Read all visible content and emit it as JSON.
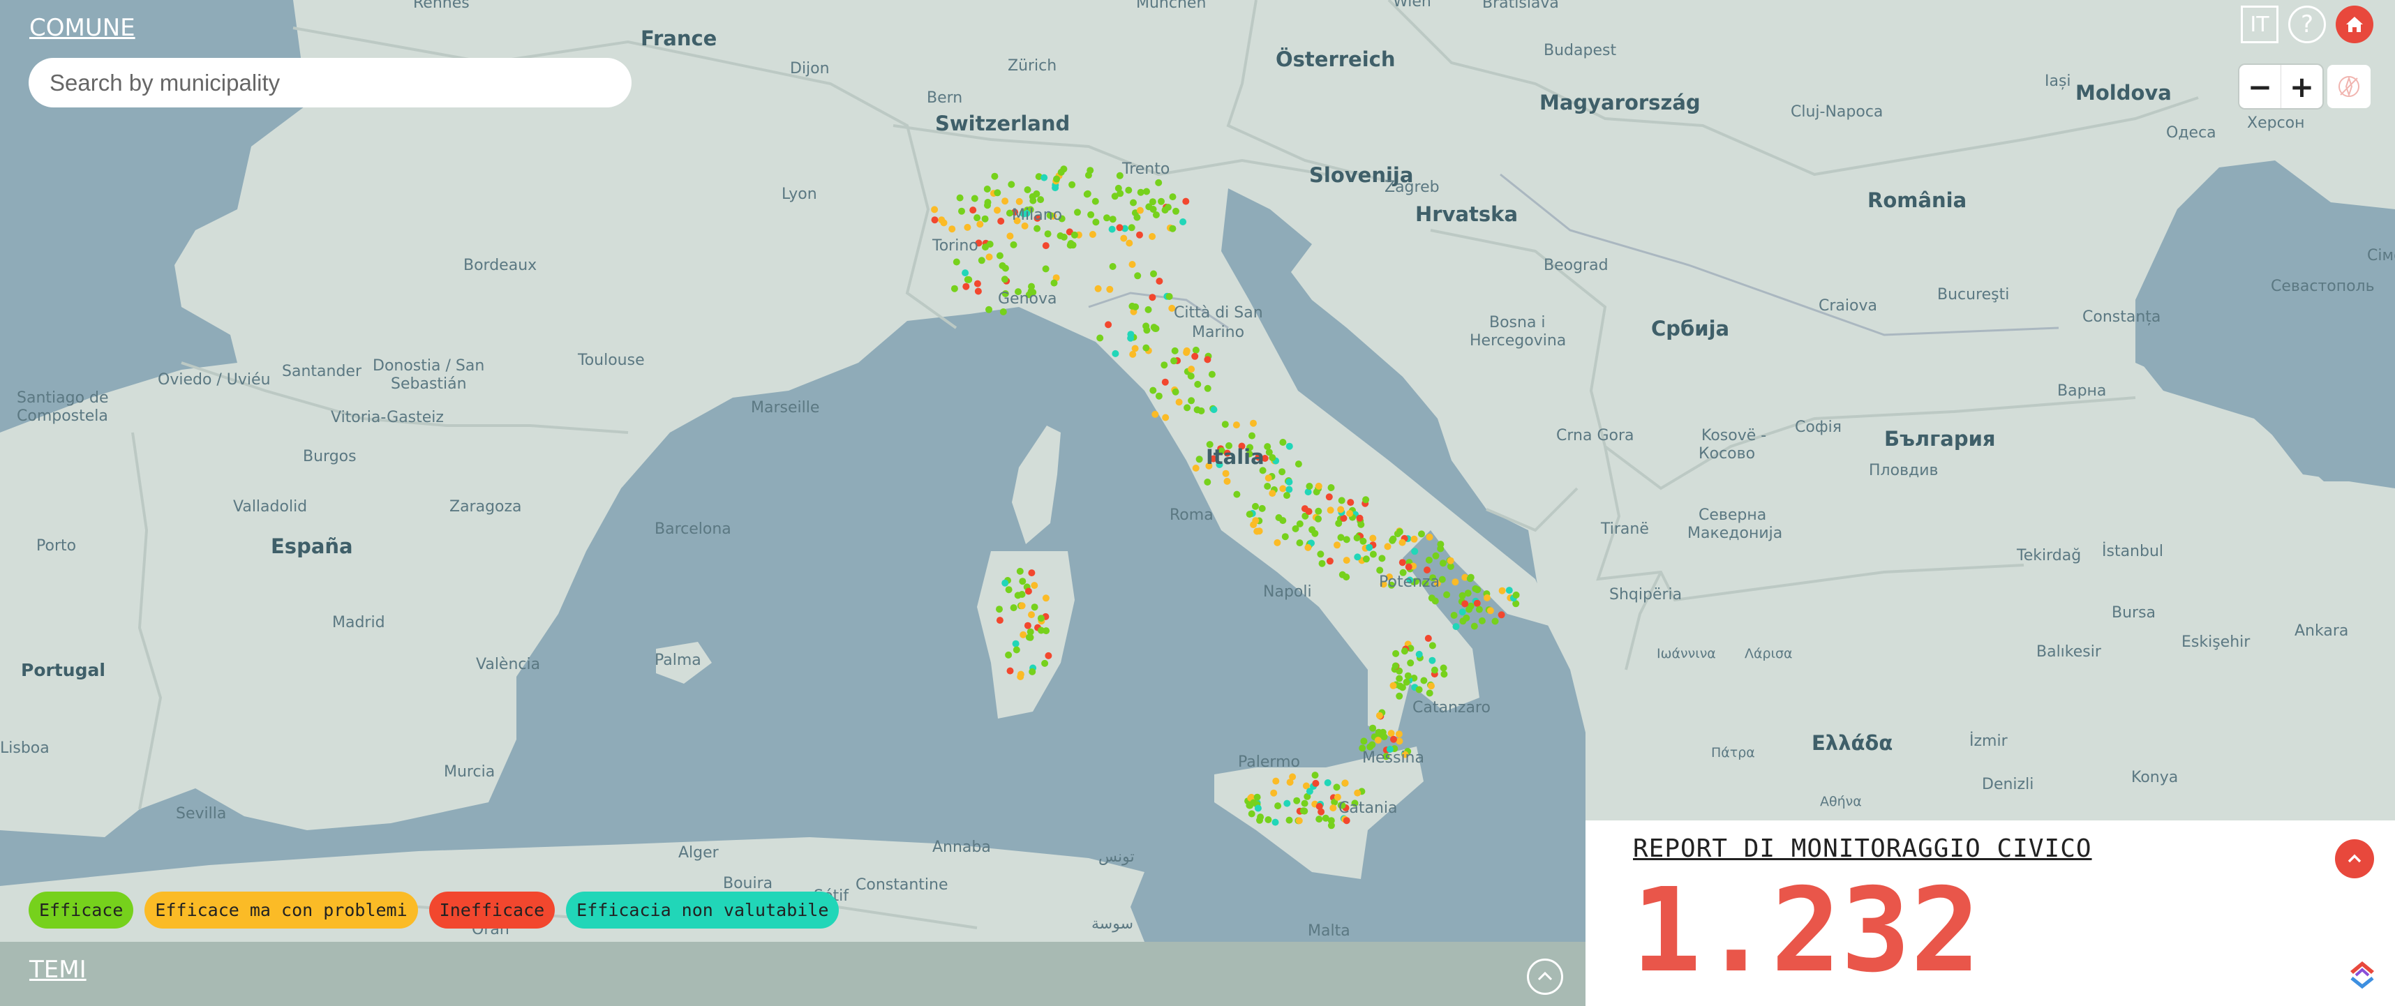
{
  "header": {
    "comune_label": "COMUNE",
    "search_placeholder": "Search by municipality"
  },
  "toolbar": {
    "language": "IT",
    "help": "?",
    "zoom_out": "−",
    "zoom_in": "+"
  },
  "legend": [
    {
      "label": "Efficace",
      "color": "#76d11c"
    },
    {
      "label": "Efficace ma con problemi",
      "color": "#fbbb26"
    },
    {
      "label": "Inefficace",
      "color": "#f2472e"
    },
    {
      "label": "Efficacia non valutabile",
      "color": "#21d6b8"
    }
  ],
  "temi": {
    "label": "TEMI"
  },
  "report": {
    "title": "REPORT DI MONITORAGGIO CIVICO",
    "count": "1.232"
  },
  "icons": {
    "home": "home-icon",
    "help": "help-icon",
    "compass": "compass-off-icon",
    "collapse": "chevron-up-icon",
    "brand": "brand-logo-icon"
  },
  "map": {
    "countries": [
      "France",
      "Switzerland",
      "Österreich",
      "Magyarország",
      "Slovenija",
      "Hrvatska",
      "România",
      "Moldova",
      "Bosna i",
      "Hercegovina",
      "Србија",
      "Crna Gora",
      "Kosovë -",
      "Косово",
      "Северна",
      "Македонија",
      "Shqipëria",
      "България",
      "Ελλάδα",
      "Italia",
      "España",
      "Portugal"
    ],
    "cities": [
      "Rennes",
      "München",
      "Wien",
      "Bratislava",
      "Budapest",
      "Zürich",
      "Bern",
      "Dijon",
      "Lyon",
      "Trento",
      "Milano",
      "Torino",
      "Genova",
      "Zagreb",
      "Bordeaux",
      "Toulouse",
      "Città di San",
      "Marino",
      "Beograd",
      "Cluj-Napoca",
      "Iași",
      "Одеса",
      "Херсон",
      "Севастополь",
      "Сімф",
      "Bucureşti",
      "Craiova",
      "Constanța",
      "Варна",
      "Santiago de",
      "Compostela",
      "Oviedo / Uviéu",
      "Santander",
      "Donostia / San",
      "Sebastián",
      "Vitoria-Gasteiz",
      "Burgos",
      "Marseille",
      "Zaragoza",
      "Valladolid",
      "Barcelona",
      "Porto",
      "Roma",
      "Napoli",
      "Potenza",
      "Tiranë",
      "Софія",
      "Пловдив",
      "Tekirdağ",
      "İstanbul",
      "Bursa",
      "Madrid",
      "València",
      "Palma",
      "Ιωάννινα",
      "Λάρισα",
      "Balıkesir",
      "Eskişehir",
      "Ankara",
      "Catanzaro",
      "Palermo",
      "Messina",
      "Catania",
      "Πάτρα",
      "Αθήνα",
      "İzmir",
      "Denizli",
      "Konya",
      "Murcia",
      "Sevilla",
      "Alger",
      "Annaba",
      "Bouira",
      "Sétif",
      "Constantine",
      "Oran",
      "تونس",
      "سوسة",
      "Malta",
      "Lisboa"
    ]
  }
}
